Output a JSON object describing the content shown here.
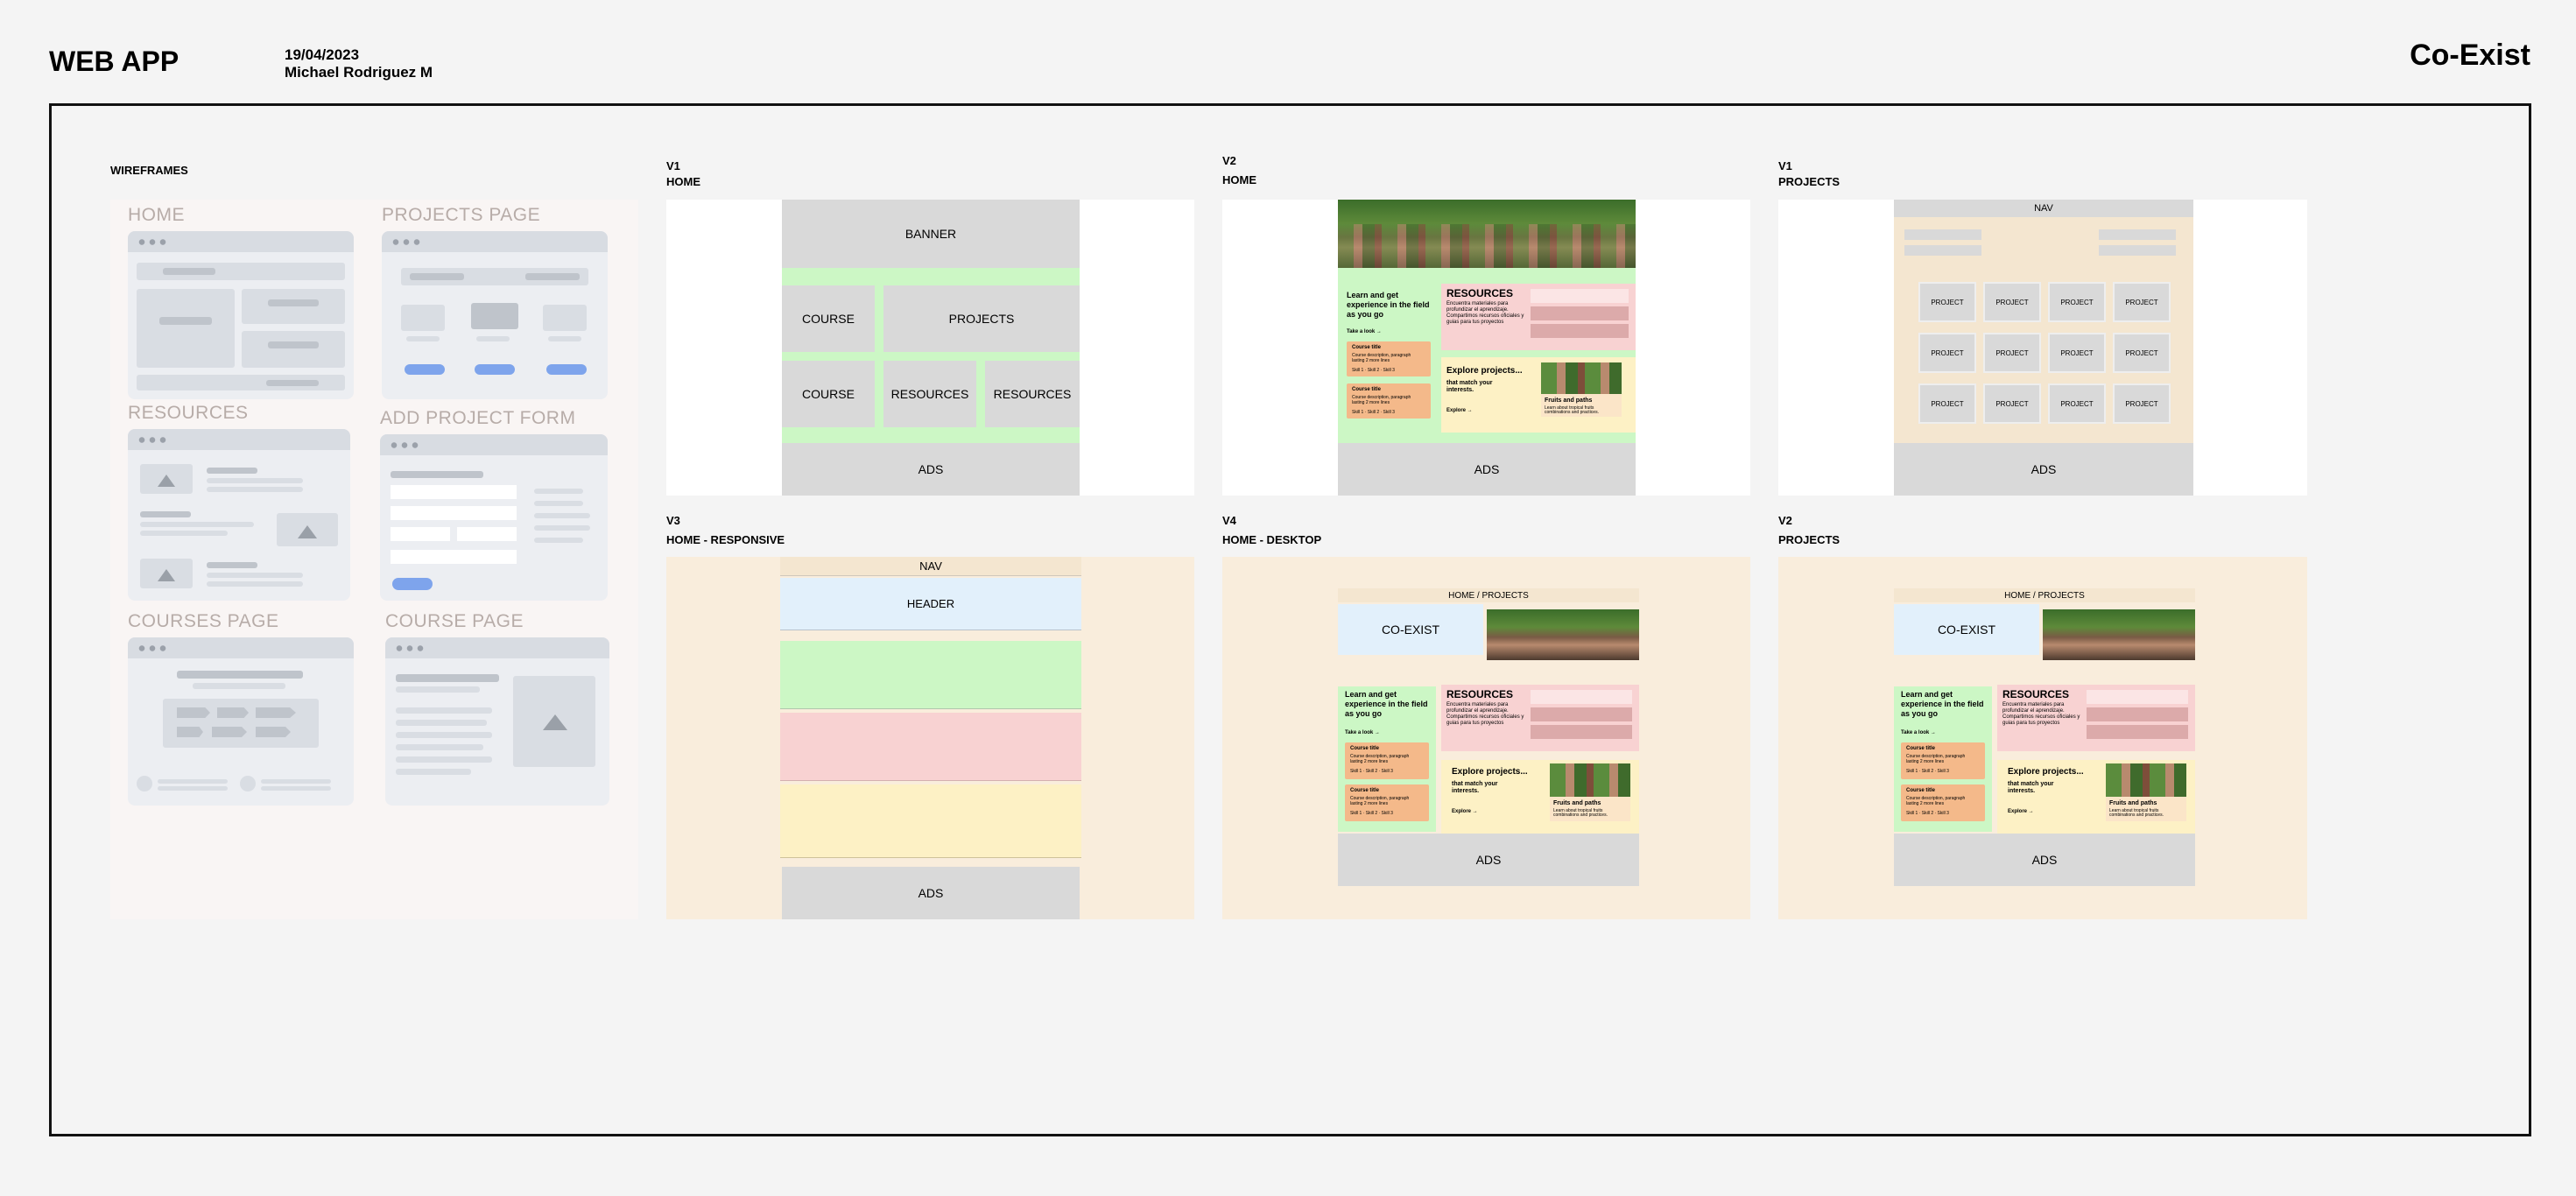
{
  "header": {
    "app_title": "WEB APP",
    "date": "19/04/2023",
    "author": "Michael Rodriguez M",
    "brand": "Co-Exist"
  },
  "wireframes": {
    "section_label": "WIREFRAMES",
    "home": "HOME",
    "projects_page": "PROJECTS PAGE",
    "resources": "RESOURCES",
    "add_project_form": "ADD PROJECT FORM",
    "courses_page": "COURSES PAGE",
    "course_page": "COURSE PAGE"
  },
  "frames": {
    "v1_home": {
      "version": "V1",
      "title": "HOME",
      "banner": "BANNER",
      "course": "COURSE",
      "projects": "PROJECTS",
      "resources": "RESOURCES",
      "ads": "ADS"
    },
    "v2_home": {
      "version": "V2",
      "title": "HOME",
      "ads": "ADS"
    },
    "v1_projects": {
      "version": "V1",
      "title": "PROJECTS",
      "nav": "NAV",
      "project": "PROJECT",
      "ads": "ADS"
    },
    "v3_home": {
      "version": "V3",
      "title": "HOME - RESPONSIVE",
      "nav": "NAV",
      "header": "HEADER",
      "ads": "ADS"
    },
    "v4_home": {
      "version": "V4",
      "title": "HOME - DESKTOP",
      "breadcrumb": "HOME / PROJECTS",
      "logo": "CO-EXIST",
      "ads": "ADS"
    },
    "v2_projects": {
      "version": "V2",
      "title": "PROJECTS",
      "breadcrumb": "HOME / PROJECTS",
      "logo": "CO-EXIST",
      "ads": "ADS"
    }
  },
  "mock": {
    "learn": "Learn and get experience in the field as you go",
    "take_look": "Take a look →",
    "course_title": "Course title",
    "course_desc": "Course description, paragraph lasting 2 more lines",
    "skills": "Skill 1 · Skill 2 · Skill 3",
    "resources_title": "RESOURCES",
    "resources_desc": "Encuentra materiales para profundizar el aprendizaje. Compartimos recursos oficiales y guias para tus proyectos",
    "explore_title": "Explore projects...",
    "explore_sub": "that match your interests.",
    "explore_link": "Explore →",
    "fruits": "Fruits and paths",
    "fruits_desc": "Learn about tropical fruits combinations and practices."
  },
  "colors": {
    "green": "#ccf7c5",
    "pink": "#f8d2d2",
    "yellow": "#fdf1c5",
    "beige": "#f4e6d0",
    "blue_light": "#e2f0fb",
    "gray": "#d9d9d9",
    "canvas": "#f4f4f4"
  }
}
